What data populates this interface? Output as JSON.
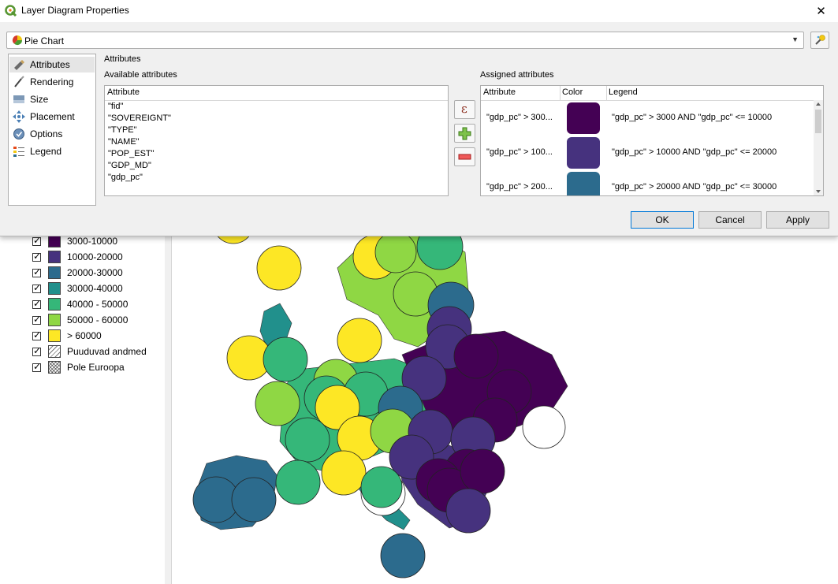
{
  "dialog": {
    "title": "Layer Diagram Properties",
    "close_glyph": "✕",
    "diagram_type": "Pie Chart",
    "section_title": "Attributes",
    "available_label": "Available attributes",
    "assigned_label": "Assigned attributes",
    "side_items": [
      {
        "label": "Attributes",
        "icon": "attributes-icon"
      },
      {
        "label": "Rendering",
        "icon": "brush-icon"
      },
      {
        "label": "Size",
        "icon": "size-icon"
      },
      {
        "label": "Placement",
        "icon": "placement-icon"
      },
      {
        "label": "Options",
        "icon": "options-icon"
      },
      {
        "label": "Legend",
        "icon": "legend-icon"
      }
    ],
    "available": {
      "header": "Attribute",
      "items": [
        "\"fid\"",
        "\"SOVEREIGNT\"",
        "\"TYPE\"",
        "\"NAME\"",
        "\"POP_EST\"",
        "\"GDP_MD\"",
        "\"gdp_pc\""
      ]
    },
    "tool_buttons": {
      "expression": "ε"
    },
    "assigned": {
      "headers": [
        "Attribute",
        "Color",
        "Legend"
      ],
      "rows": [
        {
          "attribute": "\"gdp_pc\" > 300...",
          "color": "#440154",
          "legend": "\"gdp_pc\" > 3000 AND  \"gdp_pc\" <= 10000"
        },
        {
          "attribute": "\"gdp_pc\" > 100...",
          "color": "#46327e",
          "legend": "\"gdp_pc\" > 10000 AND  \"gdp_pc\" <= 20000"
        },
        {
          "attribute": "\"gdp_pc\" > 200...",
          "color": "#2c6b8d",
          "legend": "\"gdp_pc\" > 20000 AND  \"gdp_pc\" <= 30000"
        }
      ]
    },
    "buttons": {
      "ok": "OK",
      "cancel": "Cancel",
      "apply": "Apply"
    }
  },
  "legend": [
    {
      "label": "3000-10000",
      "color": "#440154"
    },
    {
      "label": "10000-20000",
      "color": "#46327e"
    },
    {
      "label": "20000-30000",
      "color": "#2c6b8d"
    },
    {
      "label": "30000-40000",
      "color": "#21908c"
    },
    {
      "label": "40000 - 50000",
      "color": "#35b779"
    },
    {
      "label": "50000 - 60000",
      "color": "#8fd744"
    },
    {
      "label": "> 60000",
      "color": "#fde725"
    },
    {
      "label": "Puuduvad andmed",
      "color": "#ffffff",
      "pattern": "hatch"
    },
    {
      "label": "Pole Euroopa",
      "color": "#ffffff",
      "pattern": "crosshatch"
    }
  ]
}
